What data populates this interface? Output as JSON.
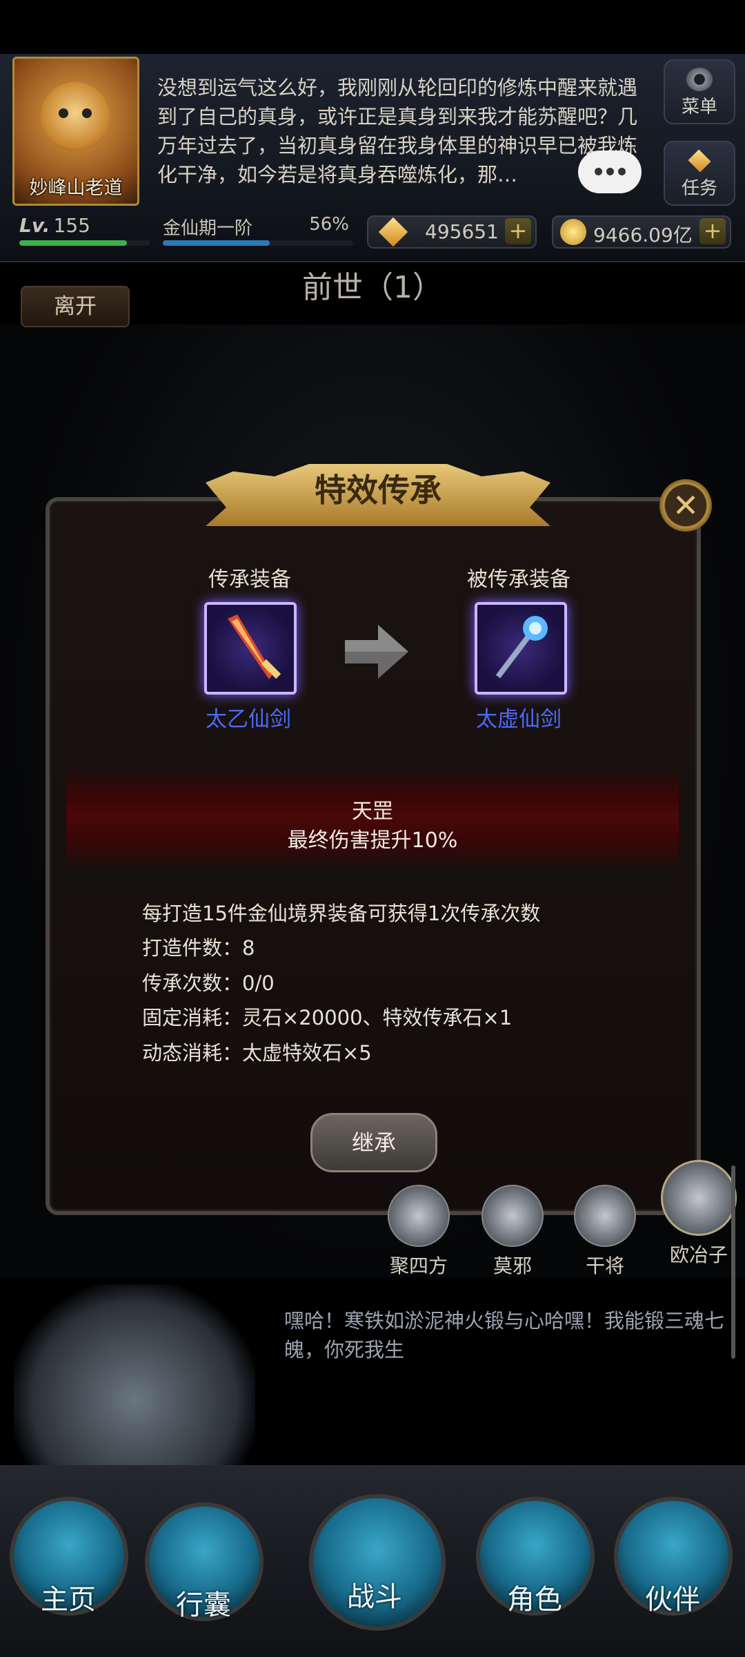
{
  "header": {
    "player_name": "妙峰山老道",
    "dialog_text": "没想到运气这么好，我刚刚从轮回印的修炼中醒来就遇到了自己的真身，或许正是真身到来我才能苏醒吧？几万年过去了，当初真身留在我身体里的神识早已被我炼化干净，如今若是将真身吞噬炼化，那…",
    "menu_label": "菜单",
    "task_label": "任务",
    "level_label": "155",
    "level_prefix": "Lv.",
    "realm_label": "金仙期一阶",
    "realm_percent_text": "56%",
    "realm_percent": 0.56,
    "level_progress": 0.82,
    "gems": "495651",
    "coins": "9466.09亿",
    "plus": "+"
  },
  "scene": {
    "title": "前世（1）",
    "leave_label": "离开"
  },
  "modal": {
    "title": "特效传承",
    "source_label": "传承装备",
    "target_label": "被传承装备",
    "source_item": "太乙仙剑",
    "target_item": "太虚仙剑",
    "effect_name": "天罡",
    "effect_desc": "最终伤害提升10%",
    "info": [
      "每打造15件金仙境界装备可获得1次传承次数",
      "打造件数：8",
      "传承次数：0/0",
      "固定消耗：灵石×20000、特效传承石×1",
      "动态消耗：太虚特效石×5"
    ],
    "button_label": "继承",
    "close_label": "✕"
  },
  "npcs": [
    "聚四方",
    "莫邪",
    "干将",
    "欧冶子"
  ],
  "story_text": "嘿哈！寒铁如淤泥神火锻与心哈嘿！我能锻三魂七魄，你死我生",
  "nav": [
    "主页",
    "行囊",
    "战斗",
    "角色",
    "伙伴"
  ],
  "colors": {
    "item_name": "#4a6aff",
    "banner_gold": "#e7c879",
    "nav_orb": "#3aa6c8"
  }
}
